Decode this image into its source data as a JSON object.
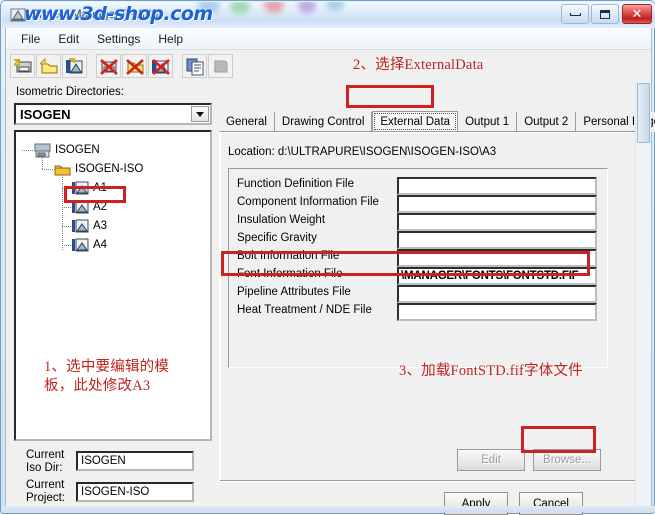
{
  "window": {
    "title": "Project Manager [FULL]",
    "watermark": "www.3d-shop.com",
    "icon": "project-manager-icon",
    "controls": {
      "minimize": "minimize-icon",
      "maximize": "maximize-icon",
      "close": "✕"
    }
  },
  "menubar": {
    "items": [
      {
        "label": "File"
      },
      {
        "label": "Edit"
      },
      {
        "label": "Settings"
      },
      {
        "label": "Help"
      }
    ]
  },
  "toolbar": {
    "buttons": [
      {
        "name": "new-iso-dir-icon",
        "tooltip": "New Iso Directory"
      },
      {
        "name": "new-project-folder-icon",
        "tooltip": "New Project"
      },
      {
        "name": "new-drawing-icon",
        "tooltip": "New Drawing"
      },
      {
        "name": "delete-iso-dir-icon",
        "tooltip": "Delete Iso Directory"
      },
      {
        "name": "delete-project-icon",
        "tooltip": "Delete Project"
      },
      {
        "name": "delete-drawing-icon",
        "tooltip": "Delete Drawing"
      },
      {
        "name": "copy-icon",
        "tooltip": "Copy"
      },
      {
        "name": "paste-icon",
        "tooltip": "Paste"
      }
    ]
  },
  "left_panel": {
    "iso_dir_label": "Isometric Directories:",
    "iso_dir_value": "ISOGEN",
    "tree": [
      {
        "label": "ISOGEN",
        "level": 0,
        "icon": "drive-icon",
        "selected": false
      },
      {
        "label": "ISOGEN-ISO",
        "level": 1,
        "icon": "folder-icon",
        "selected": false
      },
      {
        "label": "A1",
        "level": 2,
        "icon": "drawing-icon",
        "selected": false
      },
      {
        "label": "A2",
        "level": 2,
        "icon": "drawing-icon",
        "selected": false
      },
      {
        "label": "A3",
        "level": 2,
        "icon": "drawing-icon",
        "selected": true
      },
      {
        "label": "A4",
        "level": 2,
        "icon": "drawing-icon",
        "selected": false
      }
    ],
    "current": {
      "iso_dir_label": "Current\nIso Dir:",
      "iso_dir_label_line1": "Current",
      "iso_dir_label_line2": "Iso Dir:",
      "iso_dir_value": "ISOGEN",
      "project_label_line1": "Current",
      "project_label_line2": "Project:",
      "project_value": "ISOGEN-ISO"
    }
  },
  "tabs": [
    {
      "label": "General",
      "active": false
    },
    {
      "label": "Drawing Control",
      "active": false
    },
    {
      "label": "External Data",
      "active": true
    },
    {
      "label": "Output 1",
      "active": false
    },
    {
      "label": "Output 2",
      "active": false
    },
    {
      "label": "Personal Isogen",
      "active": false
    }
  ],
  "external_data": {
    "location": "Location: d:\\ULTRAPURE\\ISOGEN\\ISOGEN-ISO\\A3",
    "fields": [
      {
        "label": "Function Definition File",
        "value": ""
      },
      {
        "label": "Component Information File",
        "value": ""
      },
      {
        "label": "Insulation Weight",
        "value": ""
      },
      {
        "label": "Specific Gravity",
        "value": ""
      },
      {
        "label": "Bolt Information File",
        "value": ""
      },
      {
        "label": "Font Information File",
        "value": "\\MANAGER\\FONTS\\FONTSTD.FIF",
        "highlighted": true
      },
      {
        "label": "Pipeline Attributes File",
        "value": ""
      },
      {
        "label": "Heat Treatment / NDE File",
        "value": ""
      }
    ],
    "edit_button": "Edit",
    "browse_button": "Browse...",
    "edit_enabled": false,
    "browse_enabled": false
  },
  "dialog_buttons": {
    "apply": "Apply",
    "cancel": "Cancel"
  },
  "annotations": {
    "step1_line1": "1、选中要编辑的模",
    "step1_line2": "板，此处修改A3",
    "step2": "2、选择ExternalData",
    "step3": "3、加载FontSTD.fif字体文件"
  },
  "colors": {
    "annotation_red": "#c0241f",
    "highlight_box": "#cc2222",
    "watermark_blue": "#1a62d6",
    "panel_gray": "#f0f0f0",
    "titlebar_blue": "#dceafa"
  }
}
